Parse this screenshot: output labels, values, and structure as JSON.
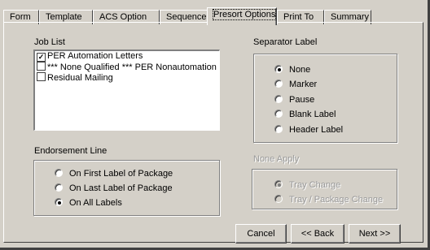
{
  "tabs": [
    {
      "label": "Form"
    },
    {
      "label": "Template"
    },
    {
      "label": "ACS Option"
    },
    {
      "label": "Sequence"
    },
    {
      "label": "Presort Options"
    },
    {
      "label": "Print To"
    },
    {
      "label": "Summary"
    }
  ],
  "active_tab": "Presort Options",
  "job_list": {
    "label": "Job List",
    "items": [
      {
        "label": "PER Automation Letters",
        "checked": true
      },
      {
        "label": "*** None Qualified *** PER Nonautomation Lett",
        "checked": false
      },
      {
        "label": "Residual Mailing",
        "checked": false
      }
    ]
  },
  "separator_label": {
    "label": "Separator Label",
    "options": [
      "None",
      "Marker",
      "Pause",
      "Blank Label",
      "Header Label"
    ],
    "selected": "None"
  },
  "endorsement_line": {
    "label": "Endorsement Line",
    "options": [
      "On First Label of Package",
      "On Last Label of Package",
      "On All Labels"
    ],
    "selected": "On All Labels"
  },
  "none_apply": {
    "label": "None Apply",
    "options": [
      "Tray Change",
      "Tray / Package Change"
    ],
    "selected": "Tray Change",
    "enabled": false
  },
  "buttons": {
    "cancel": "Cancel",
    "back": "<< Back",
    "next": "Next >>"
  },
  "colors": {
    "face": "#d4d0c8",
    "disabled_text": "#9a9a9a"
  }
}
